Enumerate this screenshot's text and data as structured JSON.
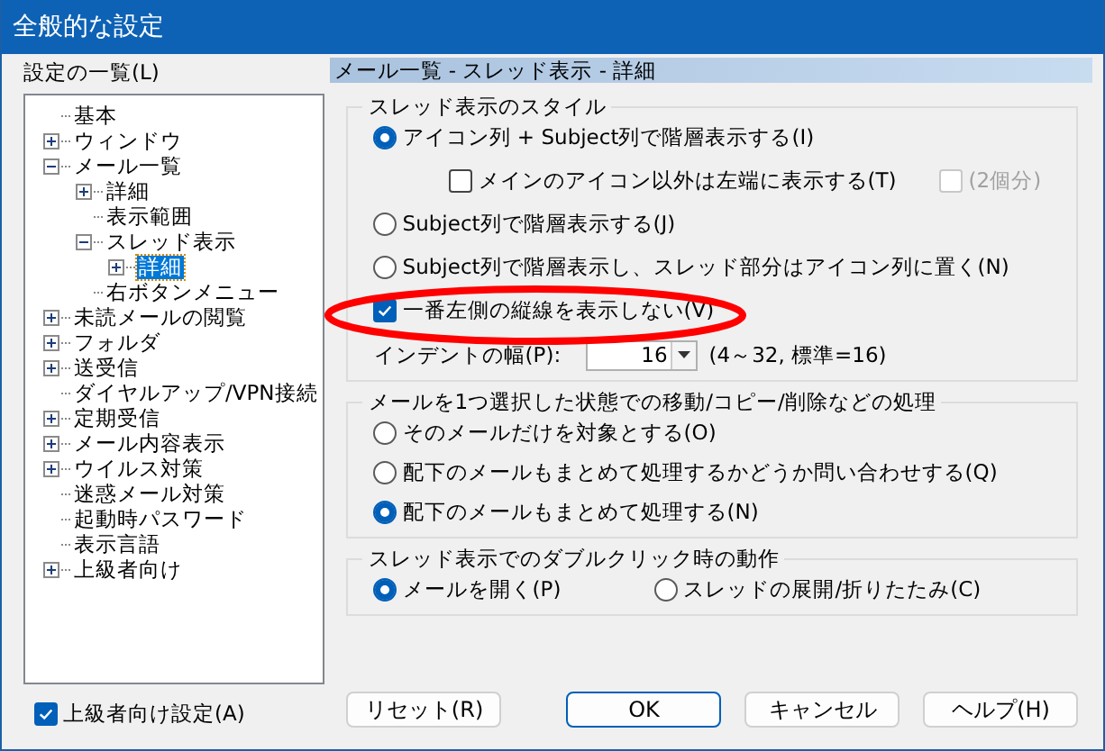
{
  "window": {
    "title": "全般的な設定"
  },
  "sidebar": {
    "label": "設定の一覧(L)",
    "tree": [
      {
        "label": "基本",
        "selected": false
      },
      {
        "label": "ウィンドウ",
        "expanded": false,
        "selected": false
      },
      {
        "label": "メール一覧",
        "expanded": true,
        "selected": false,
        "children": [
          {
            "label": "詳細",
            "expanded": false,
            "selected": false
          },
          {
            "label": "表示範囲",
            "selected": false
          },
          {
            "label": "スレッド表示",
            "expanded": true,
            "selected": false,
            "children": [
              {
                "label": "詳細",
                "expanded": false,
                "selected": true
              }
            ]
          },
          {
            "label": "右ボタンメニュー",
            "selected": false
          }
        ]
      },
      {
        "label": "未読メールの閲覧",
        "expanded": false,
        "selected": false
      },
      {
        "label": "フォルダ",
        "expanded": false,
        "selected": false
      },
      {
        "label": "送受信",
        "expanded": false,
        "selected": false
      },
      {
        "label": "ダイヤルアップ/VPN接続",
        "selected": false
      },
      {
        "label": "定期受信",
        "expanded": false,
        "selected": false
      },
      {
        "label": "メール内容表示",
        "expanded": false,
        "selected": false
      },
      {
        "label": "ウイルス対策",
        "expanded": false,
        "selected": false
      },
      {
        "label": "迷惑メール対策",
        "selected": false
      },
      {
        "label": "起動時パスワード",
        "selected": false
      },
      {
        "label": "表示言語",
        "selected": false
      },
      {
        "label": "上級者向け",
        "expanded": false,
        "selected": false
      }
    ],
    "advanced_checkbox": {
      "label": "上級者向け設定(A)",
      "checked": true
    }
  },
  "page_header": "メール一覧 - スレッド表示 - 詳細",
  "groups": [
    {
      "title": "スレッド表示のスタイル",
      "items": [
        {
          "kind": "radio",
          "label": "アイコン列 + Subject列で階層表示する(I)",
          "selected": true
        },
        {
          "kind": "subcheck",
          "label": "メインのアイコン以外は左端に表示する(T)",
          "checked": false,
          "extra": {
            "label": "(2個分)",
            "checked": false,
            "disabled": true
          }
        },
        {
          "kind": "radio",
          "label": "Subject列で階層表示する(J)",
          "selected": false
        },
        {
          "kind": "radio",
          "label": "Subject列で階層表示し、スレッド部分はアイコン列に置く(N)",
          "selected": false
        },
        {
          "kind": "checkbox",
          "label": "一番左側の縦線を表示しない(V)",
          "checked": true
        },
        {
          "kind": "spinner",
          "label": "インデントの幅(P):",
          "value": "16",
          "hint": "(4～32, 標準=16)"
        }
      ]
    },
    {
      "title": "メールを1つ選択した状態での移動/コピー/削除などの処理",
      "items": [
        {
          "kind": "radio",
          "label": "そのメールだけを対象とする(O)",
          "selected": false
        },
        {
          "kind": "radio",
          "label": "配下のメールもまとめて処理するかどうか問い合わせする(Q)",
          "selected": false
        },
        {
          "kind": "radio",
          "label": "配下のメールもまとめて処理する(N)",
          "selected": true
        }
      ]
    },
    {
      "title": "スレッド表示でのダブルクリック時の動作",
      "items": [
        {
          "kind": "radio",
          "label": "メールを開く(P)",
          "selected": true
        },
        {
          "kind": "radio",
          "label": "スレッドの展開/折りたたみ(C)",
          "selected": false
        }
      ]
    }
  ],
  "buttons": [
    {
      "label": "リセット(R)",
      "default": false
    },
    {
      "label": "OK",
      "default": true
    },
    {
      "label": "キャンセル",
      "default": false
    },
    {
      "label": "ヘルプ(H)",
      "default": false
    }
  ]
}
